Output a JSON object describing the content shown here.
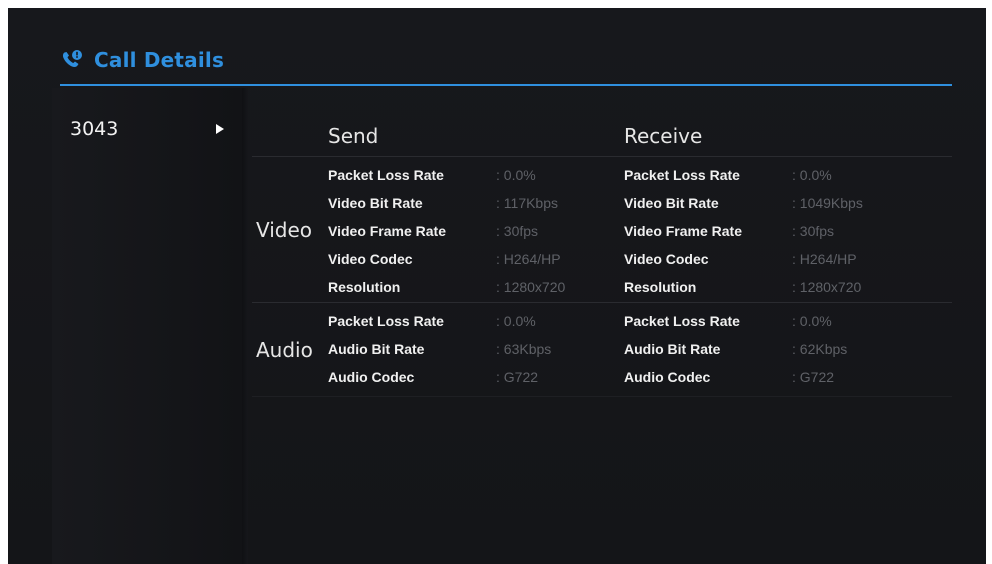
{
  "header": {
    "title": "Call Details",
    "accent_color": "#2f8fde",
    "icon": "phone-info-icon"
  },
  "call_list": {
    "items": [
      {
        "number": "3043",
        "icon": "play-arrow-icon"
      }
    ]
  },
  "columns": {
    "send": "Send",
    "receive": "Receive"
  },
  "video": {
    "label": "Video",
    "rows": [
      {
        "send_label": "Packet Loss Rate",
        "send_value": ": 0.0%",
        "recv_label": "Packet Loss Rate",
        "recv_value": ": 0.0%"
      },
      {
        "send_label": "Video Bit Rate",
        "send_value": ": 117Kbps",
        "recv_label": "Video Bit Rate",
        "recv_value": ": 1049Kbps"
      },
      {
        "send_label": "Video Frame Rate",
        "send_value": ": 30fps",
        "recv_label": "Video Frame Rate",
        "recv_value": ": 30fps"
      },
      {
        "send_label": "Video Codec",
        "send_value": ": H264/HP",
        "recv_label": "Video Codec",
        "recv_value": ": H264/HP"
      },
      {
        "send_label": "Resolution",
        "send_value": ": 1280x720",
        "recv_label": "Resolution",
        "recv_value": ": 1280x720"
      }
    ]
  },
  "audio": {
    "label": "Audio",
    "rows": [
      {
        "send_label": "Packet Loss Rate",
        "send_value": ": 0.0%",
        "recv_label": "Packet Loss Rate",
        "recv_value": ": 0.0%"
      },
      {
        "send_label": "Audio Bit Rate",
        "send_value": ": 63Kbps",
        "recv_label": "Audio Bit Rate",
        "recv_value": ": 62Kbps"
      },
      {
        "send_label": "Audio Codec",
        "send_value": ": G722",
        "recv_label": "Audio Codec",
        "recv_value": ": G722"
      }
    ]
  }
}
